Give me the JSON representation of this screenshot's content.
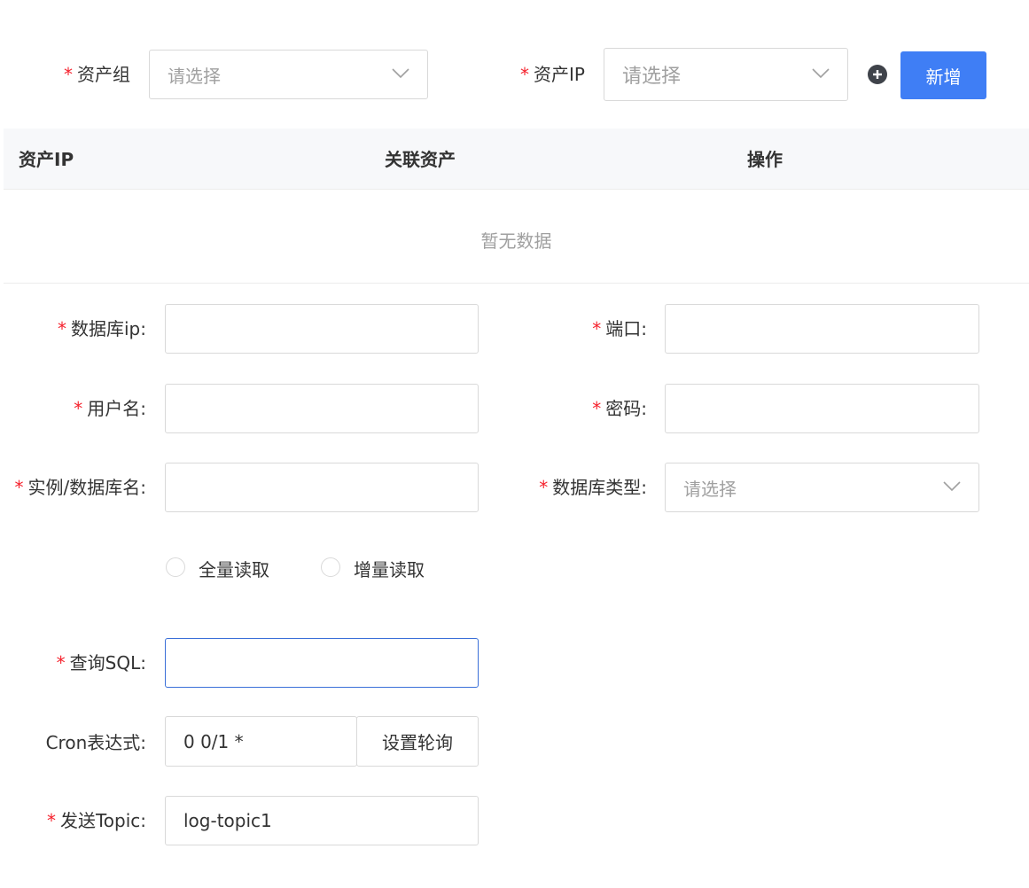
{
  "top_filter": {
    "asset_group": {
      "required": "*",
      "label": "资产组",
      "placeholder": "请选择"
    },
    "asset_ip": {
      "required": "*",
      "label": "资产IP",
      "placeholder": "请选择"
    },
    "add_button": "新增"
  },
  "table": {
    "columns": [
      "资产IP",
      "关联资产",
      "操作"
    ],
    "empty_text": "暂无数据"
  },
  "form": {
    "db_ip": {
      "required": "*",
      "label": "数据库ip:",
      "value": ""
    },
    "port": {
      "required": "*",
      "label": "端口:",
      "value": ""
    },
    "username": {
      "required": "*",
      "label": "用户名:",
      "value": ""
    },
    "password": {
      "required": "*",
      "label": "密码:",
      "value": ""
    },
    "instance": {
      "required": "*",
      "label": "实例/数据库名:",
      "value": ""
    },
    "db_type": {
      "required": "*",
      "label": "数据库类型:",
      "placeholder": "请选择"
    },
    "read_mode": {
      "options": [
        "全量读取",
        "增量读取"
      ],
      "selected": ""
    },
    "query_sql": {
      "required": "*",
      "label": "查询SQL:",
      "value": ""
    },
    "cron": {
      "label": "Cron表达式:",
      "value": "0 0/1 *",
      "button": "设置轮询"
    },
    "topic": {
      "required": "*",
      "label": "发送Topic:",
      "value": "log-topic1"
    }
  },
  "colors": {
    "primary": "#3f7ef5",
    "required": "#f5222d",
    "focus_border": "#3a6fd8",
    "placeholder": "#a0a0a0"
  }
}
